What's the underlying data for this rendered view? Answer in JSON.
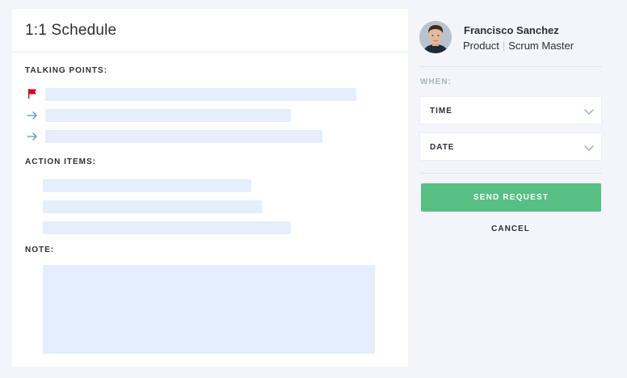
{
  "main": {
    "title": "1:1 Schedule",
    "talking_points_label": "TALKING POINTS:",
    "action_items_label": "ACTION ITEMS:",
    "note_label": "NOTE:",
    "talking_points": [
      {
        "icon": "flag-icon",
        "icon_color": "#d0021b",
        "value": ""
      },
      {
        "icon": "arrow-right-icon",
        "icon_color": "#5b8fd6",
        "value": ""
      },
      {
        "icon": "arrow-right-icon",
        "icon_color": "#5b8fd6",
        "value": ""
      }
    ],
    "action_items": [
      "",
      "",
      ""
    ],
    "note": ""
  },
  "profile": {
    "name": "Francisco Sanchez",
    "department": "Product",
    "role": "Scrum Master"
  },
  "schedule": {
    "when_label": "WHEN:",
    "time_label": "TIME",
    "date_label": "DATE"
  },
  "actions": {
    "send_label": "SEND REQUEST",
    "cancel_label": "CANCEL"
  },
  "colors": {
    "accent_green": "#57bf84",
    "placeholder_fill": "#e4eefc",
    "background": "#f3f5fa",
    "flag_red": "#d0021b",
    "arrow_blue": "#5b8fd6"
  }
}
